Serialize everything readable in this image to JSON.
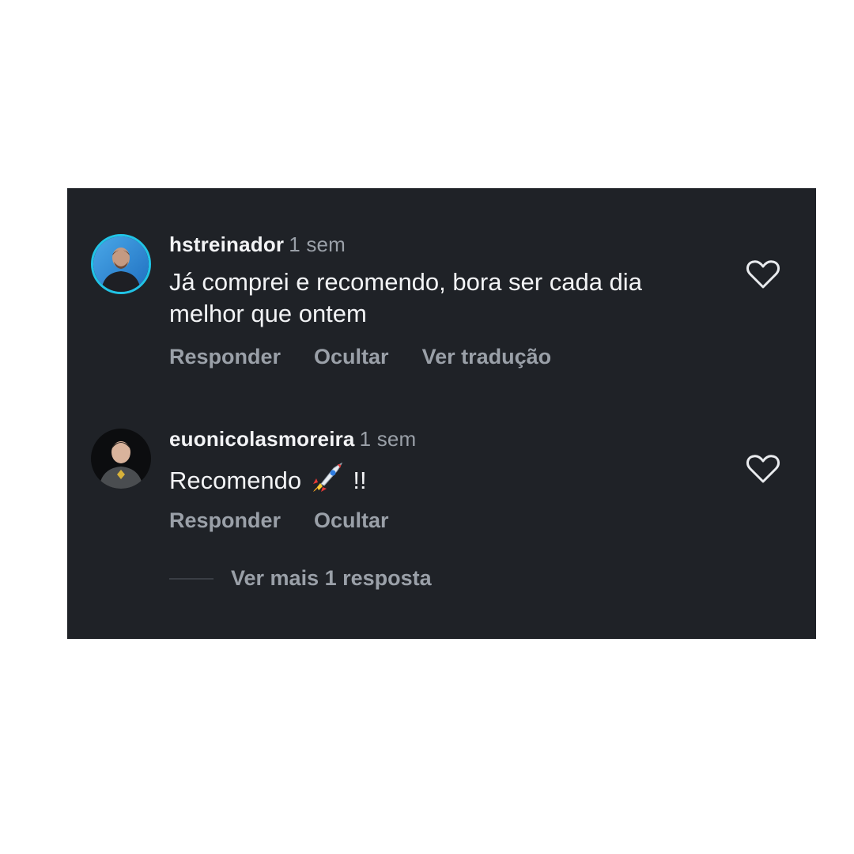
{
  "comments": [
    {
      "username": "hstreinador",
      "time": "1 sem",
      "text": "Já comprei e recomendo, bora ser cada dia melhor que ontem",
      "actions": [
        "Responder",
        "Ocultar",
        "Ver tradução"
      ],
      "avatar_ring_color": "#21c4e6"
    },
    {
      "username": "euonicolasmoreira",
      "time": "1 sem",
      "text_before_emoji": "Recomendo",
      "emoji": "rocket-icon",
      "text_after_emoji": "!!",
      "actions": [
        "Responder",
        "Ocultar"
      ]
    }
  ],
  "more_replies": {
    "label": "Ver mais 1 resposta"
  },
  "colors": {
    "panel_bg": "#1f2227",
    "primary_text": "#f2f3f5",
    "secondary_text": "#9aa0a8"
  }
}
